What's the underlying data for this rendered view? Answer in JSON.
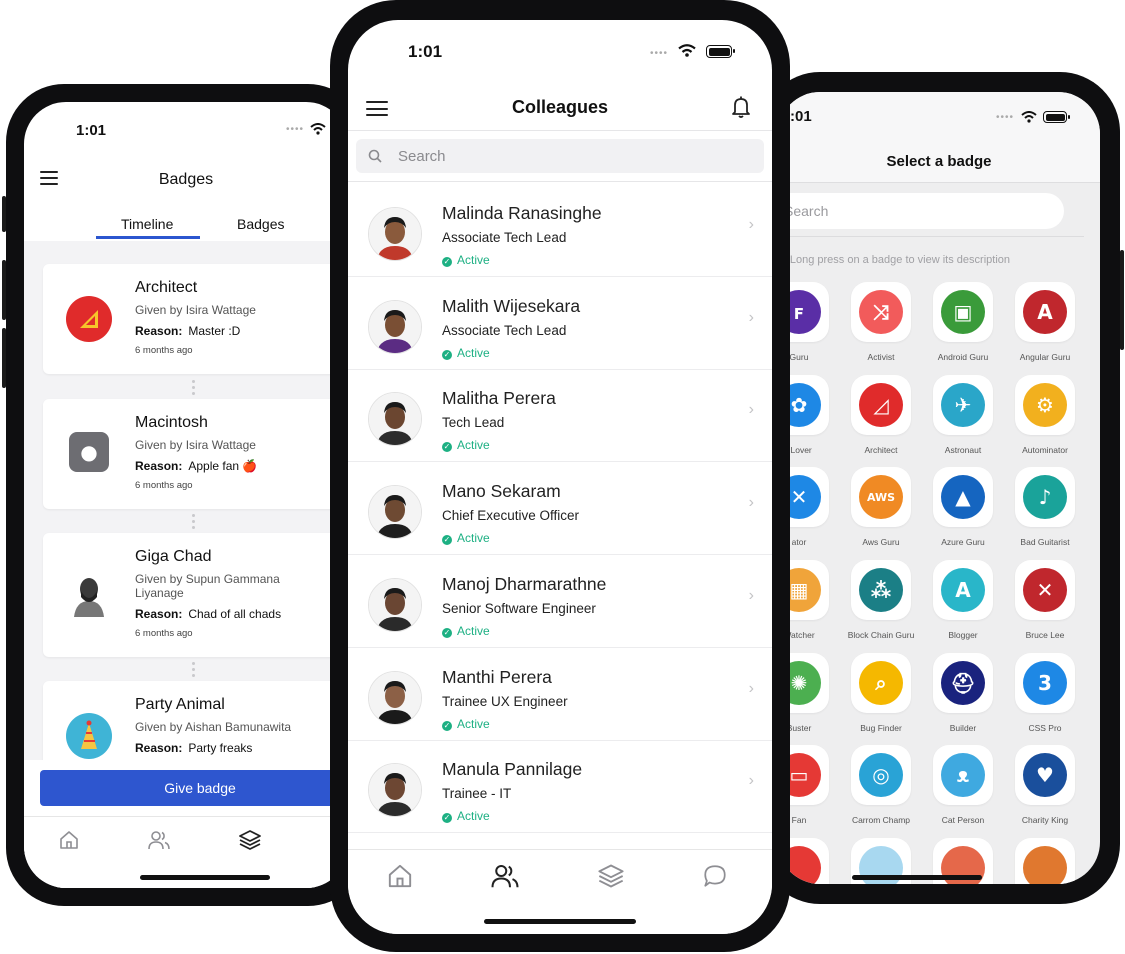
{
  "left": {
    "time": "1:01",
    "title": "Badges",
    "tabs": [
      "Timeline",
      "Badges"
    ],
    "cards": [
      {
        "name": "Architect",
        "given": "Given by Isira Wattage",
        "reason_label": "Reason:",
        "reason": "Master :D",
        "ago": "6 months ago",
        "icon": "triangle-ruler-icon",
        "color": "#e02b2b"
      },
      {
        "name": "Macintosh",
        "given": "Given by Isira Wattage",
        "reason_label": "Reason:",
        "reason": "Apple fan 🍎",
        "ago": "6 months ago",
        "icon": "apple-icon",
        "color": "#707075"
      },
      {
        "name": "Giga Chad",
        "given": "Given by Supun Gammana Liyanage",
        "reason_label": "Reason:",
        "reason": "Chad of all chads",
        "ago": "6 months ago",
        "icon": "chad-icon",
        "color": "#333"
      },
      {
        "name": "Party Animal",
        "given": "Given by Aishan Bamunawita",
        "reason_label": "Reason:",
        "reason": "Party freaks",
        "ago": "",
        "icon": "party-hat-icon",
        "color": "#3fb4d6"
      }
    ],
    "give_badge": "Give badge"
  },
  "middle": {
    "time": "1:01",
    "title": "Colleagues",
    "search_placeholder": "Search",
    "people": [
      {
        "name": "Malinda Ranasinghe",
        "role": "Associate Tech Lead",
        "status": "Active",
        "skin": "#8a5a3c",
        "shirt": "#c0392b"
      },
      {
        "name": "Malith Wijesekara",
        "role": "Associate Tech Lead",
        "status": "Active",
        "skin": "#7a4f34",
        "shirt": "#5b2c83"
      },
      {
        "name": "Malitha Perera",
        "role": "Tech Lead",
        "status": "Active",
        "skin": "#6b4630",
        "shirt": "#2c2c2c"
      },
      {
        "name": "Mano Sekaram",
        "role": "Chief Executive Officer",
        "status": "Active",
        "skin": "#6e4a33",
        "shirt": "#1e1e1e"
      },
      {
        "name": "Manoj Dharmarathne",
        "role": "Senior Software Engineer",
        "status": "Active",
        "skin": "#6a4633",
        "shirt": "#2a2a2a"
      },
      {
        "name": "Manthi Perera",
        "role": "Trainee UX Engineer",
        "status": "Active",
        "skin": "#8c6046",
        "shirt": "#1a1a1a"
      },
      {
        "name": "Manula Pannilage",
        "role": "Trainee - IT",
        "status": "Active",
        "skin": "#6d4733",
        "shirt": "#2b2b2b"
      }
    ]
  },
  "right": {
    "time": ":01",
    "title": "Select a badge",
    "search_placeholder": "Search",
    "hint": "Long press on a badge to view its description",
    "badges": [
      {
        "label": "Guru",
        "color": "#5a2ea6",
        "glyph": "ꜰ"
      },
      {
        "label": "Activist",
        "color": "#f25b5b",
        "glyph": "⤨"
      },
      {
        "label": "Android Guru",
        "color": "#3a9b3a",
        "glyph": "▣"
      },
      {
        "label": "Angular Guru",
        "color": "#c0272d",
        "glyph": "A"
      },
      {
        "label": "l Lover",
        "color": "#1e88e5",
        "glyph": "✿"
      },
      {
        "label": "Architect",
        "color": "#e02b2b",
        "glyph": "◿"
      },
      {
        "label": "Astronaut",
        "color": "#2aa6c9",
        "glyph": "✈"
      },
      {
        "label": "Autominator",
        "color": "#f2b01e",
        "glyph": "⚙"
      },
      {
        "label": "ator",
        "color": "#1e88e5",
        "glyph": "✕"
      },
      {
        "label": "Aws Guru",
        "color": "#f08a24",
        "glyph": "AWS"
      },
      {
        "label": "Azure Guru",
        "color": "#1565c0",
        "glyph": "▲"
      },
      {
        "label": "Bad Guitarist",
        "color": "#1aa39a",
        "glyph": "♪"
      },
      {
        "label": "Watcher",
        "color": "#f0a43a",
        "glyph": "▦"
      },
      {
        "label": "Block Chain Guru",
        "color": "#1b7f86",
        "glyph": "⁂"
      },
      {
        "label": "Blogger",
        "color": "#29b6c9",
        "glyph": "A"
      },
      {
        "label": "Bruce Lee",
        "color": "#c0272d",
        "glyph": "✕"
      },
      {
        "label": "Buster",
        "color": "#4caf50",
        "glyph": "✺"
      },
      {
        "label": "Bug Finder",
        "color": "#f5b800",
        "glyph": "⌕"
      },
      {
        "label": "Builder",
        "color": "#1a237e",
        "glyph": "⛑"
      },
      {
        "label": "CSS Pro",
        "color": "#1e88e5",
        "glyph": "3"
      },
      {
        "label": "Fan",
        "color": "#e53935",
        "glyph": "▭"
      },
      {
        "label": "Carrom Champ",
        "color": "#29a3d6",
        "glyph": "◎"
      },
      {
        "label": "Cat Person",
        "color": "#3fa9e0",
        "glyph": "ᴥ"
      },
      {
        "label": "Charity King",
        "color": "#1a4f9c",
        "glyph": "♥"
      }
    ]
  }
}
